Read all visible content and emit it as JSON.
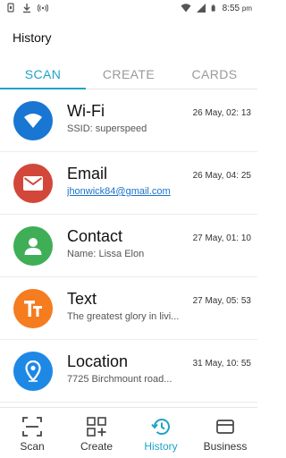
{
  "status_bar": {
    "time": "8:55",
    "time_suffix": "pm"
  },
  "header": {
    "title": "History"
  },
  "tabs": [
    {
      "label": "SCAN",
      "active": true
    },
    {
      "label": "CREATE",
      "active": false
    },
    {
      "label": "CARDS",
      "active": false
    }
  ],
  "history": [
    {
      "title": "Wi-Fi",
      "time": "26 May, 02: 13",
      "subtitle": "SSID: superspeed",
      "icon": "wifi-icon",
      "color": "#1976d2"
    },
    {
      "title": "Email",
      "time": "26 May, 04: 25",
      "subtitle": "jhonwick84@gmail.com",
      "icon": "mail-icon",
      "color": "#d2473a"
    },
    {
      "title": "Contact",
      "time": "27 May, 01: 10",
      "subtitle": "Name: Lissa Elon",
      "icon": "person-icon",
      "color": "#3fae57"
    },
    {
      "title": "Text",
      "time": "27 May, 05: 53",
      "subtitle": "The greatest glory in livi...",
      "icon": "text-icon",
      "color": "#f57c1f"
    },
    {
      "title": "Location",
      "time": "31 May, 10: 55",
      "subtitle": "7725 Birchmount road...",
      "icon": "location-pin-icon",
      "color": "#1e88e5"
    }
  ],
  "bottom_nav": [
    {
      "label": "Scan",
      "icon": "scan-icon",
      "active": false
    },
    {
      "label": "Create",
      "icon": "create-grid-icon",
      "active": false
    },
    {
      "label": "History",
      "icon": "history-icon",
      "active": true
    },
    {
      "label": "Business",
      "icon": "card-icon",
      "active": false
    }
  ],
  "colors": {
    "accent": "#1fa3c7",
    "link": "#1a73c8"
  }
}
